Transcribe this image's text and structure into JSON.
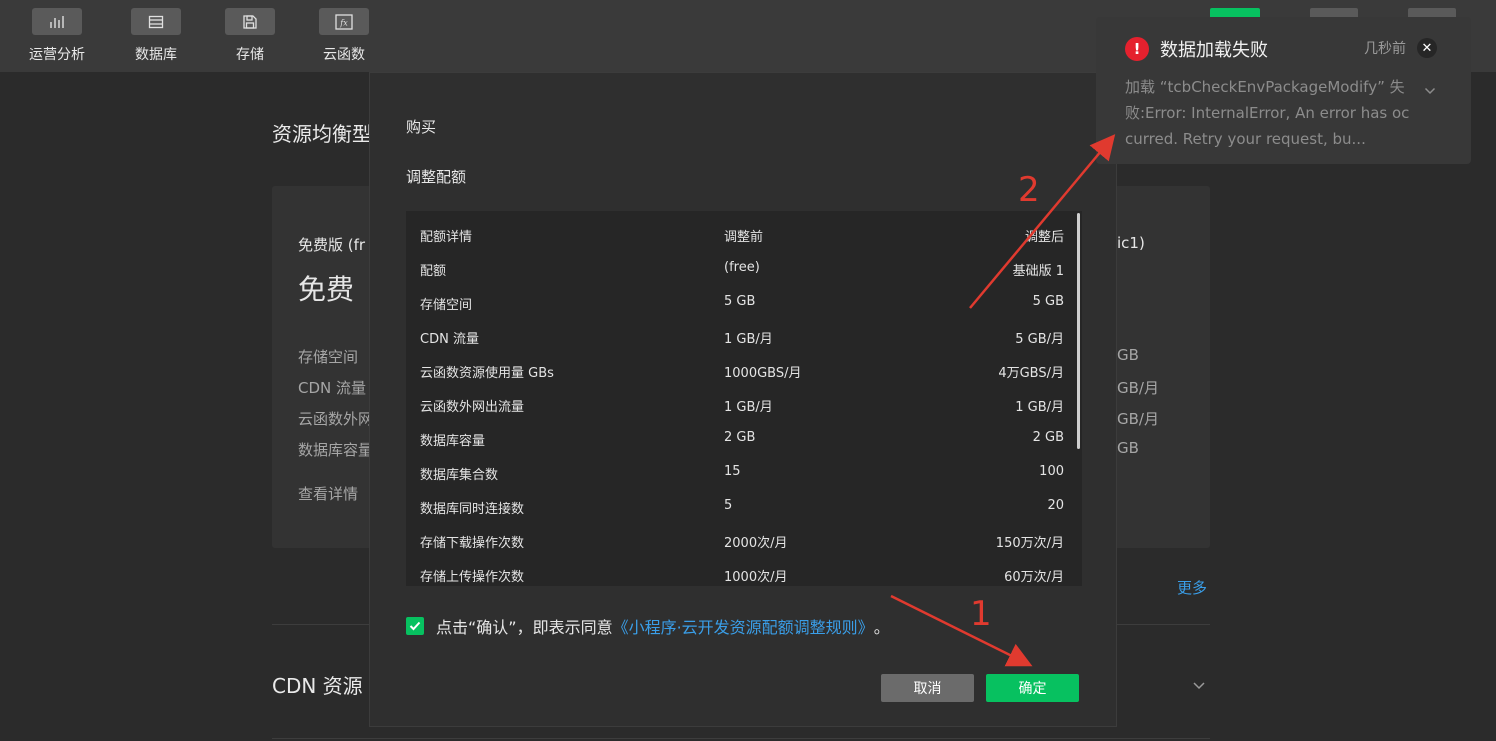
{
  "toolbar": {
    "items": [
      {
        "label": "运营分析",
        "icon": "bar-chart-icon"
      },
      {
        "label": "数据库",
        "icon": "database-icon"
      },
      {
        "label": "存储",
        "icon": "save-icon"
      },
      {
        "label": "云函数",
        "icon": "function-icon"
      }
    ]
  },
  "background": {
    "section_title": "资源均衡型",
    "plan_name": "免费版 (fr",
    "plan_price": "免费",
    "plan_right_suffix": "ic1)",
    "rows": [
      "存储空间",
      "CDN 流量",
      "云函数外网",
      "数据库容量"
    ],
    "right_values": [
      "GB",
      "GB/月",
      "GB/月",
      "GB"
    ],
    "view_details": "查看详情",
    "more": "更多",
    "cdn_section_title": "CDN 资源"
  },
  "modal": {
    "purchase_label": "购买",
    "adjust_label": "调整配额",
    "table": {
      "headers": [
        "配额详情",
        "调整前",
        "调整后"
      ],
      "rows": [
        [
          "配额",
          "(free)",
          "基础版 1"
        ],
        [
          "存储空间",
          "5 GB",
          "5 GB"
        ],
        [
          "CDN 流量",
          "1 GB/月",
          "5 GB/月"
        ],
        [
          "云函数资源使用量 GBs",
          "1000GBS/月",
          "4万GBS/月"
        ],
        [
          "云函数外网出流量",
          "1 GB/月",
          "1 GB/月"
        ],
        [
          "数据库容量",
          "2 GB",
          "2 GB"
        ],
        [
          "数据库集合数",
          "15",
          "100"
        ],
        [
          "数据库同时连接数",
          "5",
          "20"
        ],
        [
          "存储下载操作次数",
          "2000次/月",
          "150万次/月"
        ],
        [
          "存储上传操作次数",
          "1000次/月",
          "60万次/月"
        ]
      ]
    },
    "agree_prefix": "点击“确认”，即表示同意",
    "agree_link": "《小程序·云开发资源配额调整规则》",
    "agree_suffix": "。",
    "cancel_label": "取消",
    "confirm_label": "确定"
  },
  "toast": {
    "icon": "error-icon",
    "title": "数据加载失败",
    "time": "几秒前",
    "message": "加载 “tcbCheckEnvPackageModify” 失败:Error: InternalError, An error has occurred. Retry your request, bu..."
  },
  "annotations": {
    "marker_1": "1",
    "marker_2": "2"
  },
  "colors": {
    "accent_green": "#07c160",
    "link_blue": "#3a9ee8",
    "error_red": "#e5212e",
    "annotation_red": "#e03a2f"
  }
}
